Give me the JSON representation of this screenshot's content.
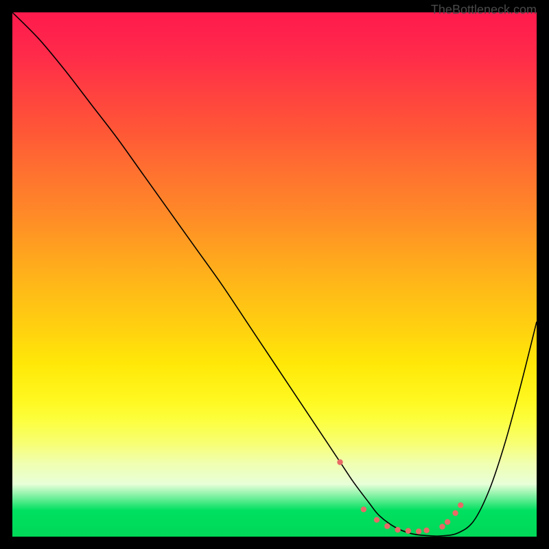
{
  "watermark": "TheBottleneck.com",
  "chart_data": {
    "type": "line",
    "title": "",
    "xlabel": "",
    "ylabel": "",
    "xlim": [
      0,
      100
    ],
    "ylim": [
      0,
      100
    ],
    "series": [
      {
        "name": "bottleneck-curve",
        "x": [
          0,
          5,
          10,
          15,
          20,
          25,
          30,
          35,
          40,
          45,
          50,
          55,
          60,
          62,
          65,
          68,
          70,
          73,
          76,
          79,
          82,
          85,
          88,
          91,
          94,
          97,
          100
        ],
        "values": [
          100,
          95,
          89,
          82.5,
          76,
          69,
          62,
          55,
          48,
          40.5,
          33,
          25.5,
          18,
          15,
          10.5,
          6.5,
          4,
          1.8,
          0.6,
          0.2,
          0.15,
          0.7,
          3,
          9,
          18,
          29,
          41
        ]
      }
    ],
    "annotations": {
      "minimum_region_dots": [
        {
          "x": 62.5,
          "y": 14.2
        },
        {
          "x": 67.0,
          "y": 5.2
        },
        {
          "x": 69.5,
          "y": 3.2
        },
        {
          "x": 71.5,
          "y": 2.0
        },
        {
          "x": 73.5,
          "y": 1.3
        },
        {
          "x": 75.5,
          "y": 1.1
        },
        {
          "x": 77.5,
          "y": 1.0
        },
        {
          "x": 79.0,
          "y": 1.2
        },
        {
          "x": 82.0,
          "y": 1.9
        },
        {
          "x": 83.0,
          "y": 2.8
        },
        {
          "x": 84.5,
          "y": 4.5
        },
        {
          "x": 85.5,
          "y": 6.0
        }
      ]
    },
    "gradient_stops": [
      {
        "pos": 0,
        "color": "#ff1a4d"
      },
      {
        "pos": 50,
        "color": "#ffb818"
      },
      {
        "pos": 78,
        "color": "#fcff40"
      },
      {
        "pos": 92,
        "color": "#e8ffd8"
      },
      {
        "pos": 100,
        "color": "#00d858"
      }
    ]
  }
}
